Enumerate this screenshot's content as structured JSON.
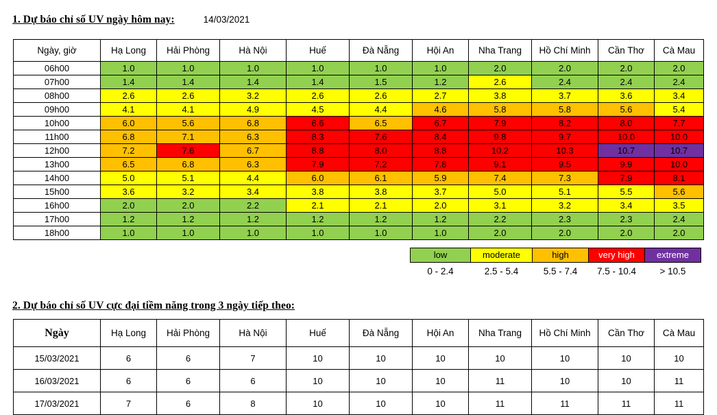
{
  "sections": {
    "hourly": {
      "heading": "1. Dự báo chỉ số UV ngày hôm nay:",
      "date": "14/03/2021"
    },
    "daily": {
      "heading": "2. Dự báo chỉ số UV cực đại tiềm năng trong 3 ngày tiếp theo:"
    }
  },
  "colors": {
    "low": "#92D050",
    "moderate": "#FFFF00",
    "high": "#FFC000",
    "very_high": "#FF0000",
    "extreme": "#7030A0",
    "none": "#FFFFFF"
  },
  "hourly_table": {
    "columns": [
      "Ngày, giờ",
      "Hạ Long",
      "Hải Phòng",
      "Hà Nội",
      "Huế",
      "Đà Nẵng",
      "Hội An",
      "Nha Trang",
      "Hồ Chí Minh",
      "Cần Thơ",
      "Cà Mau"
    ],
    "rows": [
      {
        "time": "06h00",
        "values": [
          "1.0",
          "1.0",
          "1.0",
          "1.0",
          "1.0",
          "1.0",
          "2.0",
          "2.0",
          "2.0",
          "2.0"
        ],
        "levels": [
          "low",
          "low",
          "low",
          "low",
          "low",
          "low",
          "low",
          "low",
          "low",
          "low"
        ]
      },
      {
        "time": "07h00",
        "values": [
          "1.4",
          "1.4",
          "1.4",
          "1.4",
          "1.5",
          "1.2",
          "2.6",
          "2.4",
          "2.4",
          "2.4"
        ],
        "levels": [
          "low",
          "low",
          "low",
          "low",
          "low",
          "low",
          "moderate",
          "low",
          "low",
          "low"
        ]
      },
      {
        "time": "08h00",
        "values": [
          "2.6",
          "2.6",
          "3.2",
          "2.6",
          "2.6",
          "2.7",
          "3.8",
          "3.7",
          "3.6",
          "3.4"
        ],
        "levels": [
          "moderate",
          "moderate",
          "moderate",
          "moderate",
          "moderate",
          "moderate",
          "moderate",
          "moderate",
          "moderate",
          "moderate"
        ]
      },
      {
        "time": "09h00",
        "values": [
          "4.1",
          "4.1",
          "4.9",
          "4.5",
          "4.4",
          "4.6",
          "5.8",
          "5.8",
          "5.6",
          "5.4"
        ],
        "levels": [
          "moderate",
          "moderate",
          "moderate",
          "moderate",
          "moderate",
          "high",
          "high",
          "high",
          "high",
          "moderate"
        ]
      },
      {
        "time": "10h00",
        "values": [
          "6.0",
          "5.6",
          "6.8",
          "6.6",
          "6.5",
          "6.7",
          "7.9",
          "8.2",
          "8.0",
          "7.7"
        ],
        "levels": [
          "high",
          "high",
          "high",
          "very_high",
          "high",
          "very_high",
          "very_high",
          "very_high",
          "very_high",
          "very_high"
        ]
      },
      {
        "time": "11h00",
        "values": [
          "6.8",
          "7.1",
          "6.3",
          "8.3",
          "7.6",
          "8.4",
          "9.8",
          "9.7",
          "10.0",
          "10.0"
        ],
        "levels": [
          "high",
          "high",
          "high",
          "very_high",
          "very_high",
          "very_high",
          "very_high",
          "very_high",
          "very_high",
          "very_high"
        ]
      },
      {
        "time": "12h00",
        "values": [
          "7.2",
          "7.6",
          "6.7",
          "8.8",
          "8.0",
          "8.8",
          "10.2",
          "10.3",
          "10.7",
          "10.7"
        ],
        "levels": [
          "high",
          "very_high",
          "high",
          "very_high",
          "very_high",
          "very_high",
          "very_high",
          "very_high",
          "extreme",
          "extreme"
        ]
      },
      {
        "time": "13h00",
        "values": [
          "6.5",
          "6.8",
          "6.3",
          "7.9",
          "7.2",
          "7.8",
          "9.1",
          "9.5",
          "9.9",
          "10.0"
        ],
        "levels": [
          "high",
          "high",
          "high",
          "very_high",
          "very_high",
          "very_high",
          "very_high",
          "very_high",
          "very_high",
          "very_high"
        ]
      },
      {
        "time": "14h00",
        "values": [
          "5.0",
          "5.1",
          "4.4",
          "6.0",
          "6.1",
          "5.9",
          "7.4",
          "7.3",
          "7.9",
          "8.1"
        ],
        "levels": [
          "moderate",
          "moderate",
          "moderate",
          "high",
          "high",
          "high",
          "high",
          "high",
          "very_high",
          "very_high"
        ]
      },
      {
        "time": "15h00",
        "values": [
          "3.6",
          "3.2",
          "3.4",
          "3.8",
          "3.8",
          "3.7",
          "5.0",
          "5.1",
          "5.5",
          "5.6"
        ],
        "levels": [
          "moderate",
          "moderate",
          "moderate",
          "moderate",
          "moderate",
          "moderate",
          "moderate",
          "moderate",
          "moderate",
          "high"
        ]
      },
      {
        "time": "16h00",
        "values": [
          "2.0",
          "2.0",
          "2.2",
          "2.1",
          "2.1",
          "2.0",
          "3.1",
          "3.2",
          "3.4",
          "3.5"
        ],
        "levels": [
          "low",
          "low",
          "low",
          "moderate",
          "moderate",
          "moderate",
          "moderate",
          "moderate",
          "moderate",
          "moderate"
        ]
      },
      {
        "time": "17h00",
        "values": [
          "1.2",
          "1.2",
          "1.2",
          "1.2",
          "1.2",
          "1.2",
          "2.2",
          "2.3",
          "2.3",
          "2.4"
        ],
        "levels": [
          "low",
          "low",
          "low",
          "low",
          "low",
          "low",
          "low",
          "low",
          "low",
          "low"
        ]
      },
      {
        "time": "18h00",
        "values": [
          "1.0",
          "1.0",
          "1.0",
          "1.0",
          "1.0",
          "1.0",
          "2.0",
          "2.0",
          "2.0",
          "2.0"
        ],
        "levels": [
          "low",
          "low",
          "low",
          "low",
          "low",
          "low",
          "low",
          "low",
          "low",
          "low"
        ]
      }
    ]
  },
  "legend": {
    "items": [
      {
        "label": "low",
        "range": "0 - 2.4",
        "level": "low"
      },
      {
        "label": "moderate",
        "range": "2.5 - 5.4",
        "level": "moderate"
      },
      {
        "label": "high",
        "range": "5.5 - 7.4",
        "level": "high"
      },
      {
        "label": "very high",
        "range": "7.5 - 10.4",
        "level": "very_high"
      },
      {
        "label": "extreme",
        "range": "> 10.5",
        "level": "extreme"
      }
    ]
  },
  "daily_table": {
    "columns": [
      "Ngày",
      "Hạ Long",
      "Hải Phòng",
      "Hà Nội",
      "Huế",
      "Đà Nẵng",
      "Hội An",
      "Nha Trang",
      "Hồ Chí Minh",
      "Cần Thơ",
      "Cà Mau"
    ],
    "rows": [
      {
        "date": "15/03/2021",
        "values": [
          "6",
          "6",
          "7",
          "10",
          "10",
          "10",
          "10",
          "10",
          "10",
          "10"
        ]
      },
      {
        "date": "16/03/2021",
        "values": [
          "6",
          "6",
          "6",
          "10",
          "10",
          "10",
          "11",
          "10",
          "10",
          "11"
        ]
      },
      {
        "date": "17/03/2021",
        "values": [
          "7",
          "6",
          "8",
          "10",
          "10",
          "10",
          "11",
          "11",
          "11",
          "11"
        ]
      }
    ]
  }
}
